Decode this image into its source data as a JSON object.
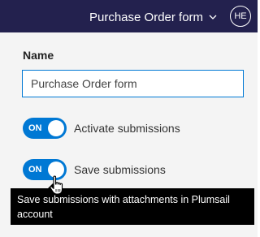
{
  "header": {
    "form_title": "Purchase Order form",
    "chevron_icon": "chevron-down-icon",
    "avatar_initials": "HE",
    "background_color": "#23214e"
  },
  "panel": {
    "name_label": "Name",
    "name_value": "Purchase Order form",
    "toggles": [
      {
        "state_label": "ON",
        "label": "Activate submissions",
        "enabled": true
      },
      {
        "state_label": "ON",
        "label": "Save submissions",
        "enabled": true
      }
    ],
    "accent_color": "#0078d4"
  },
  "tooltip": {
    "text": "Save submissions with attachments in Plumsail account"
  },
  "cursor_icon": "hand-pointer-icon"
}
